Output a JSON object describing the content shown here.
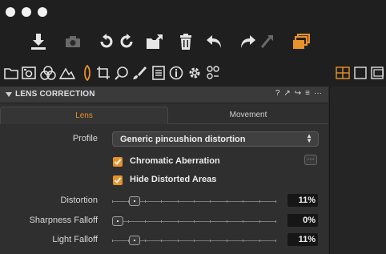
{
  "accent_color": "#e8922a",
  "toolbar": {
    "icons": [
      "import-icon",
      "camera-icon",
      "rotate-left-icon",
      "rotate-right-icon",
      "export-icon",
      "trash-icon",
      "undo-icon",
      "redo-icon",
      "redo-disabled-icon",
      "variants-icon"
    ]
  },
  "tool_tabs": [
    "folder-icon",
    "capture-icon",
    "color-icon",
    "exposure-icon",
    "lens-icon",
    "crop-icon",
    "focus-icon",
    "brush-icon",
    "metadata-icon",
    "info-icon",
    "settings-icon",
    "batch-icon"
  ],
  "panel": {
    "section_title": "LENS CORRECTION",
    "header_tools": [
      "?",
      "↗",
      "↪",
      "≡",
      "···"
    ],
    "tabs": {
      "lens": "Lens",
      "movement": "Movement"
    },
    "profile": {
      "label": "Profile",
      "value": "Generic pincushion distortion"
    },
    "checkboxes": [
      {
        "label": "Chromatic Aberration",
        "checked": true
      },
      {
        "label": "Hide Distorted Areas",
        "checked": true
      }
    ],
    "more_label": "···",
    "sliders": [
      {
        "label": "Distortion",
        "value_text": "11%",
        "value": 11
      },
      {
        "label": "Sharpness Falloff",
        "value_text": "0%",
        "value": 0
      },
      {
        "label": "Light Falloff",
        "value_text": "11%",
        "value": 11
      }
    ]
  }
}
